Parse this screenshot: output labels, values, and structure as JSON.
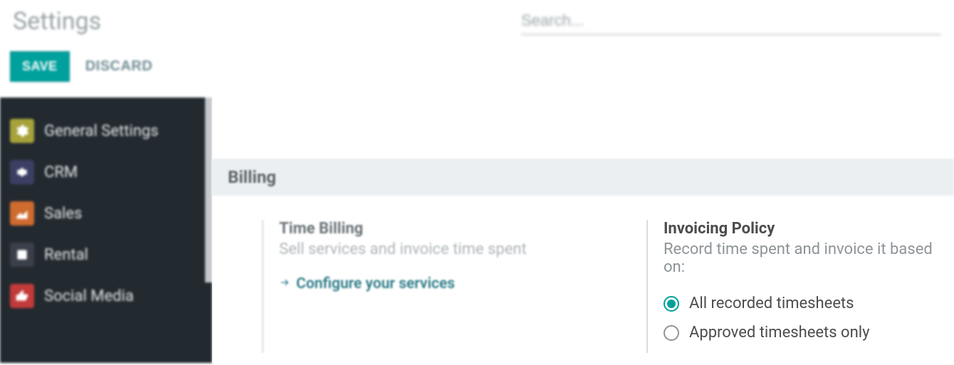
{
  "header": {
    "title": "Settings",
    "search_placeholder": "Search..."
  },
  "actions": {
    "save_label": "SAVE",
    "discard_label": "DISCARD"
  },
  "sidebar": {
    "items": [
      {
        "label": "General Settings",
        "icon": "gear-icon"
      },
      {
        "label": "CRM",
        "icon": "handshake-icon"
      },
      {
        "label": "Sales",
        "icon": "chart-icon"
      },
      {
        "label": "Rental",
        "icon": "key-icon"
      },
      {
        "label": "Social Media",
        "icon": "thumbs-up-icon"
      }
    ]
  },
  "section": {
    "title": "Billing",
    "time_billing": {
      "title": "Time Billing",
      "desc": "Sell services and invoice time spent",
      "link": "Configure your services"
    },
    "invoicing_policy": {
      "title": "Invoicing Policy",
      "desc": "Record time spent and invoice it based on:",
      "options": [
        {
          "label": "All recorded timesheets",
          "selected": true
        },
        {
          "label": "Approved timesheets only",
          "selected": false
        }
      ]
    }
  }
}
